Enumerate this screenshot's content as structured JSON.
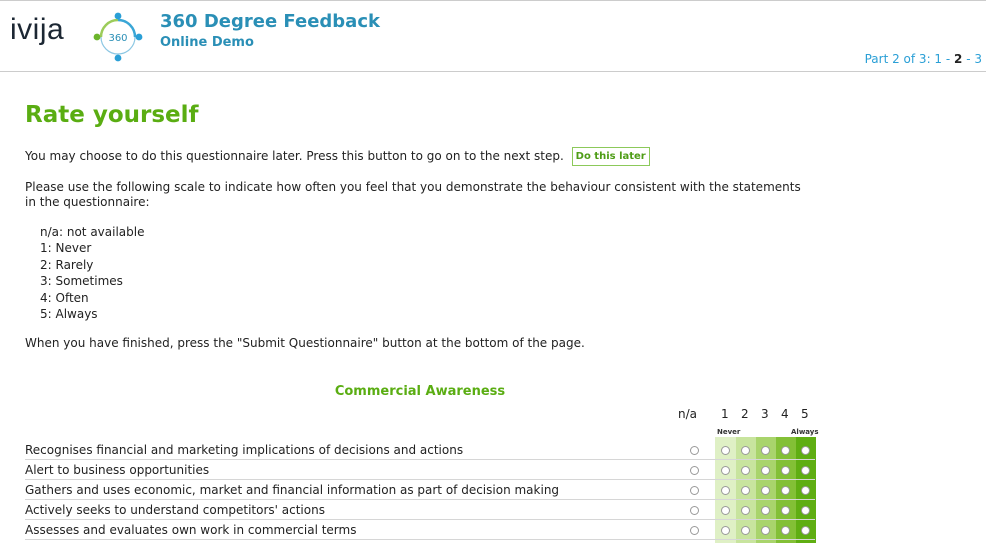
{
  "header": {
    "logo_text": "ivija",
    "logo_badge": "360",
    "title": "360 Degree Feedback",
    "subtitle": "Online Demo",
    "progress_prefix": "Part 2 of 3: ",
    "progress_pages": [
      "1",
      "2",
      "3"
    ],
    "progress_sep": " - "
  },
  "main": {
    "title": "Rate yourself",
    "later_text": "You may choose to do this questionnaire later. Press this button to go on to the next step.",
    "later_button": "Do this later",
    "scale_intro": "Please use the following scale to indicate how often you feel that you demonstrate the behaviour consistent with the statements in the questionnaire:",
    "scale": [
      "n/a: not available",
      "1: Never",
      "2: Rarely",
      "3: Sometimes",
      "4: Often",
      "5: Always"
    ],
    "finish_text": "When you have finished, press the \"Submit Questionnaire\" button at the bottom of the page."
  },
  "questionnaire": {
    "section_title": "Commercial Awareness",
    "columns": [
      "n/a",
      "1",
      "2",
      "3",
      "4",
      "5"
    ],
    "low_label": "Never",
    "high_label": "Always",
    "band_colors": [
      "#dff0c5",
      "#c8e49e",
      "#a9d46c",
      "#83c036",
      "#5fae12"
    ],
    "rows": [
      "Recognises financial and marketing implications of decisions and actions",
      "Alert to business opportunities",
      "Gathers and uses economic, market and financial information as part of decision making",
      "Actively seeks to understand competitors' actions",
      "Assesses and evaluates own work in commercial terms"
    ]
  }
}
